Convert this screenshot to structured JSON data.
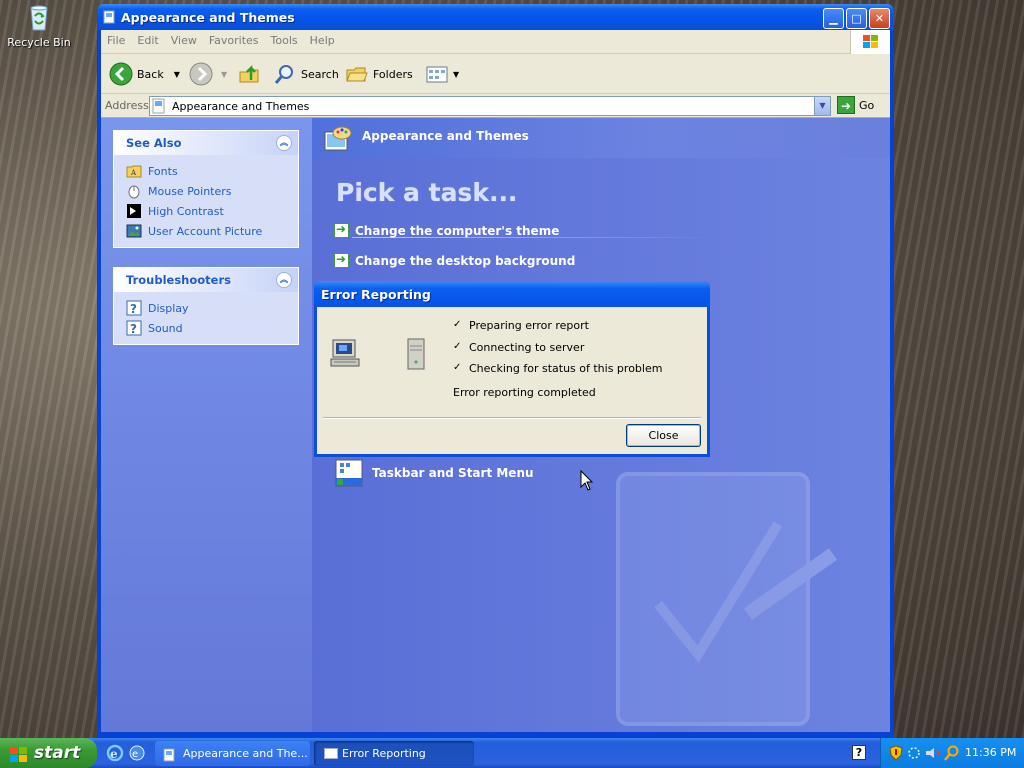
{
  "desktop": {
    "recycle_bin_label": "Recycle Bin"
  },
  "window": {
    "title": "Appearance and Themes",
    "menu": [
      "File",
      "Edit",
      "View",
      "Favorites",
      "Tools",
      "Help"
    ],
    "toolbar": {
      "back": "Back",
      "search": "Search",
      "folders": "Folders"
    },
    "address": {
      "label": "Address",
      "value": "Appearance and Themes",
      "go": "Go"
    }
  },
  "left_panel": {
    "see_also": {
      "title": "See Also",
      "items": [
        "Fonts",
        "Mouse Pointers",
        "High Contrast",
        "User Account Picture"
      ]
    },
    "troubleshooters": {
      "title": "Troubleshooters",
      "items": [
        "Display",
        "Sound"
      ]
    }
  },
  "main": {
    "header": "Appearance and Themes",
    "pick_task": "Pick a task...",
    "tasks": [
      "Change the computer's theme",
      "Change the desktop background"
    ],
    "control_panel_icon": "Taskbar and Start Menu"
  },
  "dialog": {
    "title": "Error Reporting",
    "steps": [
      {
        "check": "✓",
        "text": "Preparing error report"
      },
      {
        "check": "✓",
        "text": "Connecting to server"
      },
      {
        "check": "✓",
        "text": "Checking for status of this problem"
      }
    ],
    "status": "Error reporting completed",
    "close": "Close"
  },
  "taskbar": {
    "start": "start",
    "buttons": [
      "Appearance and The...",
      "Error Reporting"
    ],
    "clock": "11:36 PM"
  },
  "colors": {
    "xp_blue": "#0842d4",
    "panel_link": "#215dc6",
    "start_green": "#3a9a34"
  }
}
